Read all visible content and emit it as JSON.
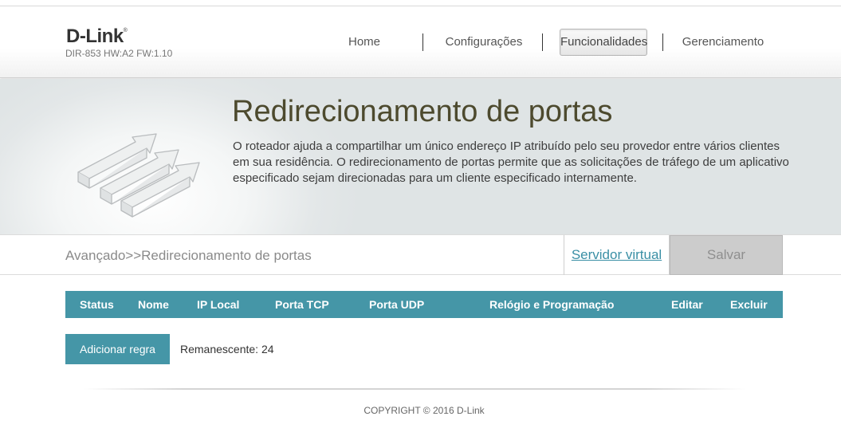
{
  "header": {
    "logo": "D-Link",
    "model_info": "DIR-853 HW:A2 FW:1.10",
    "nav": {
      "home": "Home",
      "settings": "Configurações",
      "features": "Funcionalidades",
      "management": "Gerenciamento"
    },
    "active_nav": "Funcionalidades"
  },
  "banner": {
    "title": "Redirecionamento de portas",
    "description": "O roteador ajuda a compartilhar um único endereço IP atribuído pelo seu provedor entre vários clientes em sua residência. O redirecionamento de portas permite que as solicitações de tráfego de um aplicativo especificado sejam direcionadas para um cliente especificado internamente.",
    "icon": "port-forwarding-arrows-icon"
  },
  "subbar": {
    "breadcrumb": "Avançado>>Redirecionamento de portas",
    "virtual_server_link": "Servidor virtual",
    "save_label": "Salvar"
  },
  "table": {
    "columns": {
      "status": "Status",
      "name": "Nome",
      "local_ip": "IP Local",
      "tcp_port": "Porta TCP",
      "udp_port": "Porta UDP",
      "schedule": "Relógio e Programação",
      "edit": "Editar",
      "delete": "Excluir"
    },
    "rows": []
  },
  "actions": {
    "add_rule_label": "Adicionar regra",
    "remaining_label": "Remanescente: 24"
  },
  "footer": {
    "copyright": "COPYRIGHT © 2016 D-Link"
  },
  "colors": {
    "accent": "#4596a7",
    "link": "#3a8fa5",
    "title": "#4d4a2e"
  }
}
